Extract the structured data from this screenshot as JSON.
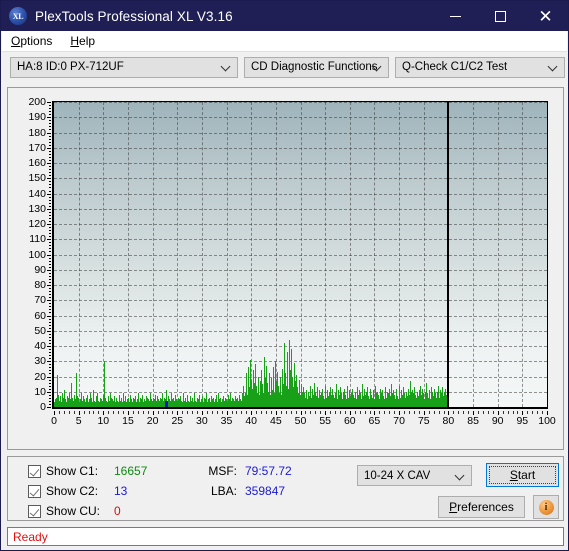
{
  "window": {
    "title": "PlexTools Professional XL V3.16",
    "icon": "XL",
    "app_icon_name": "plextools-xl-logo",
    "minimize_label": "—",
    "maximize_label": "☐",
    "close_label": "✕",
    "titlebar_color": "#1f1f55"
  },
  "menu": {
    "items": [
      {
        "label": "Options",
        "mnemonic": "O"
      },
      {
        "label": "Help",
        "mnemonic": "H"
      }
    ]
  },
  "toolbar": {
    "drive_combo": {
      "value": "HA:8 ID:0  PX-712UF"
    },
    "function_combo": {
      "value": "CD Diagnostic Functions"
    },
    "test_combo": {
      "value": "Q-Check C1/C2 Test"
    }
  },
  "controls": {
    "checkboxes": [
      {
        "label": "Show C1:",
        "checked": true,
        "value": "16657",
        "color": "#0f8a0f"
      },
      {
        "label": "Show C2:",
        "checked": true,
        "value": "13",
        "color": "#1a1ad2"
      },
      {
        "label": "Show CU:",
        "checked": true,
        "value": "0",
        "color": "#d01010"
      }
    ],
    "msf_label": "MSF:",
    "msf_value": "79:57.72",
    "lba_label": "LBA:",
    "lba_value": "359847",
    "speed_combo": {
      "value": "10-24 X CAV"
    },
    "start_label": "Start",
    "start_mnemonic": "S",
    "preferences_label": "Preferences",
    "preferences_mnemonic": "P",
    "info_icon": "info-icon"
  },
  "status": {
    "text": "Ready",
    "color": "#e11010"
  },
  "chart_data": {
    "type": "bar",
    "title": "",
    "xlabel": "",
    "ylabel": "",
    "xlim": [
      0,
      100
    ],
    "ylim": [
      0,
      200
    ],
    "grid": true,
    "x_ticks": [
      0,
      5,
      10,
      15,
      20,
      25,
      30,
      35,
      40,
      45,
      50,
      55,
      60,
      65,
      70,
      75,
      80,
      85,
      90,
      95,
      100
    ],
    "y_ticks": [
      0,
      10,
      20,
      30,
      40,
      50,
      60,
      70,
      80,
      90,
      100,
      110,
      120,
      130,
      140,
      150,
      160,
      170,
      180,
      190,
      200
    ],
    "data_end_x": 80,
    "series": [
      {
        "name": "C1",
        "color": "#18a018",
        "x_start": 0,
        "x_end": 80,
        "values": [
          3,
          5,
          4,
          6,
          21,
          8,
          4,
          5,
          7,
          3,
          9,
          6,
          4,
          11,
          5,
          3,
          7,
          4,
          6,
          9,
          5,
          3,
          16,
          6,
          4,
          8,
          5,
          3,
          22,
          7,
          4,
          6,
          3,
          5,
          9,
          4,
          3,
          7,
          5,
          3,
          4,
          6,
          8,
          3,
          5,
          4,
          9,
          6,
          3,
          5,
          11,
          4,
          3,
          7,
          5,
          9,
          4,
          3,
          6,
          5,
          3,
          4,
          8,
          5,
          30,
          6,
          4,
          3,
          7,
          5,
          4,
          9,
          6,
          3,
          5,
          4,
          7,
          3,
          5,
          6,
          4,
          3,
          8,
          5,
          4,
          6,
          3,
          9,
          5,
          4,
          7,
          3,
          5,
          4,
          6,
          3,
          8,
          5,
          4,
          3,
          6,
          5,
          4,
          7,
          3,
          5,
          9,
          4,
          3,
          6,
          5,
          4,
          8,
          3,
          5,
          4,
          7,
          3,
          6,
          5,
          4,
          3,
          9,
          5,
          4,
          6,
          3,
          5,
          8,
          4,
          3,
          7,
          5,
          4,
          6,
          3,
          5,
          9,
          4,
          3,
          6,
          5,
          11,
          4,
          3,
          7,
          5,
          4,
          9,
          3,
          5,
          6,
          4,
          3,
          8,
          5,
          4,
          6,
          3,
          5,
          7,
          4,
          3,
          9,
          5,
          4,
          6,
          3,
          5,
          8,
          4,
          3,
          7,
          5,
          4,
          6,
          3,
          5,
          9,
          4,
          3,
          6,
          5,
          4,
          8,
          3,
          5,
          7,
          4,
          3,
          6,
          5,
          4,
          9,
          3,
          5,
          6,
          4,
          3,
          7,
          5,
          4,
          6,
          3,
          5,
          8,
          4,
          3,
          9,
          5,
          4,
          6,
          3,
          5,
          7,
          4,
          3,
          6,
          5,
          4,
          8,
          3,
          5,
          9,
          4,
          3,
          6,
          5,
          4,
          7,
          3,
          5,
          6,
          4,
          3,
          8,
          5,
          4,
          9,
          3,
          14,
          7,
          9,
          22,
          11,
          8,
          26,
          13,
          9,
          31,
          18,
          12,
          24,
          16,
          10,
          28,
          14,
          9,
          20,
          12,
          8,
          17,
          11,
          24,
          15,
          9,
          33,
          19,
          13,
          27,
          16,
          10,
          22,
          14,
          8,
          19,
          11,
          26,
          15,
          9,
          30,
          17,
          11,
          23,
          14,
          9,
          20,
          12,
          8,
          25,
          15,
          10,
          42,
          22,
          14,
          36,
          19,
          12,
          44,
          24,
          16,
          38,
          20,
          13,
          29,
          17,
          11,
          21,
          13,
          9,
          18,
          12,
          8,
          15,
          10,
          7,
          13,
          9,
          6,
          11,
          8,
          5,
          10,
          7,
          14,
          9,
          6,
          12,
          8,
          5,
          16,
          10,
          7,
          13,
          9,
          6,
          11,
          8,
          5,
          9,
          12,
          7,
          5,
          14,
          9,
          6,
          11,
          7,
          5,
          10,
          13,
          8,
          5,
          12,
          8,
          6,
          9,
          15,
          7,
          5,
          11,
          8,
          6,
          13,
          9,
          5,
          10,
          7,
          12,
          8,
          5,
          14,
          9,
          6,
          11,
          7,
          5,
          9,
          12,
          8,
          6,
          10,
          7,
          5,
          13,
          8,
          6,
          11,
          9,
          5,
          15,
          10,
          7,
          12,
          8,
          5,
          10,
          13,
          7,
          5,
          9,
          12,
          8,
          6,
          11,
          7,
          5,
          14,
          9,
          6,
          10,
          8,
          5,
          12,
          9,
          6,
          11,
          7,
          5,
          13,
          8,
          6,
          10,
          9,
          5,
          12,
          7,
          15,
          9,
          6,
          11,
          8,
          5,
          10,
          12,
          7,
          5,
          14,
          9,
          6,
          11,
          8,
          5,
          13,
          9,
          6,
          10,
          7,
          5,
          12,
          8,
          17,
          10,
          6,
          11,
          9,
          5,
          13,
          8,
          6,
          10,
          7,
          5,
          11,
          14,
          8,
          6,
          12,
          9,
          5,
          10,
          7,
          16,
          9,
          6,
          11,
          8,
          5,
          13,
          10,
          7,
          5,
          12,
          9,
          6,
          10,
          8,
          14,
          6,
          11,
          9,
          5,
          13,
          7,
          5,
          10,
          12,
          8,
          6,
          9
        ]
      },
      {
        "name": "C2",
        "color": "#1414c8",
        "points": [
          {
            "x": 22.9,
            "value": 4
          }
        ]
      },
      {
        "name": "CU",
        "color": "#d01010",
        "points": []
      }
    ]
  }
}
